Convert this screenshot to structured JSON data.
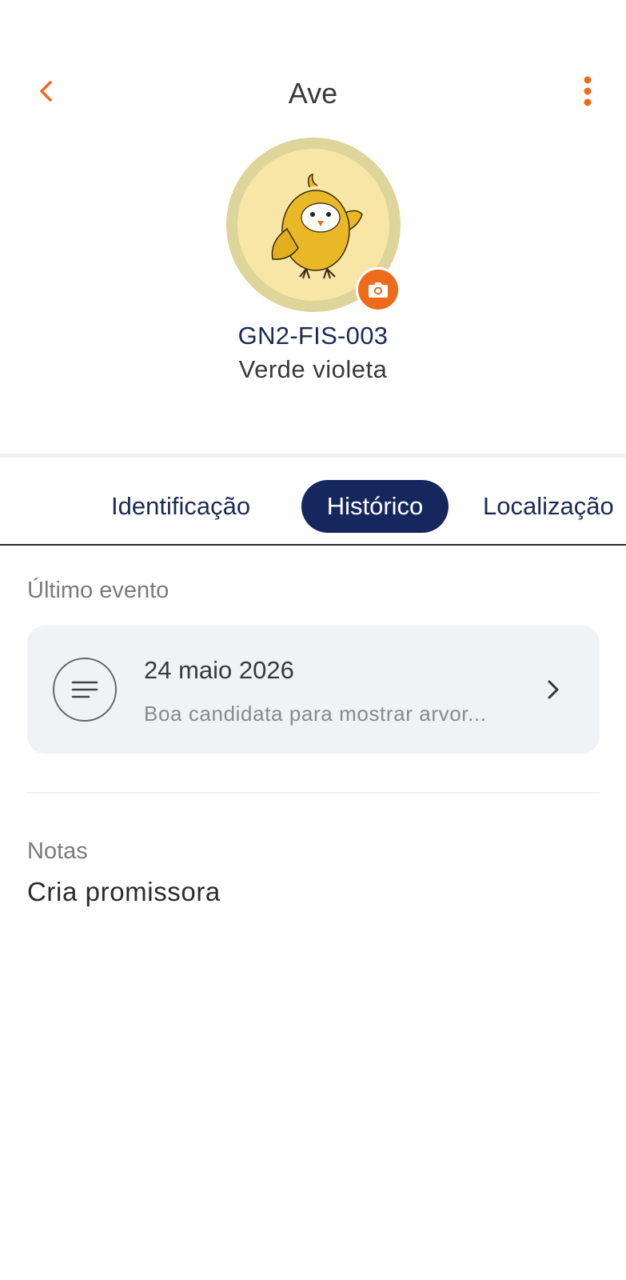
{
  "header": {
    "title": "Ave",
    "back_icon": "chevron-left-icon",
    "more_icon": "more-vertical-icon"
  },
  "profile": {
    "id_code": "GN2-FIS-003",
    "name": "Verde violeta",
    "avatar_icon": "bird-illustration",
    "camera_icon": "camera-icon"
  },
  "tabs": [
    {
      "label": "Identificação",
      "active": false
    },
    {
      "label": "Histórico",
      "active": true
    },
    {
      "label": "Localização",
      "active": false
    }
  ],
  "last_event": {
    "section_label": "Último evento",
    "date": "24 maio 2026",
    "description": "Boa candidata para mostrar arvor...",
    "icon": "notes-icon"
  },
  "notes": {
    "label": "Notas",
    "value": "Cria promissora"
  },
  "colors": {
    "accent": "#ee6b1c",
    "navy": "#15275d",
    "card_bg": "#f1f2f6"
  }
}
